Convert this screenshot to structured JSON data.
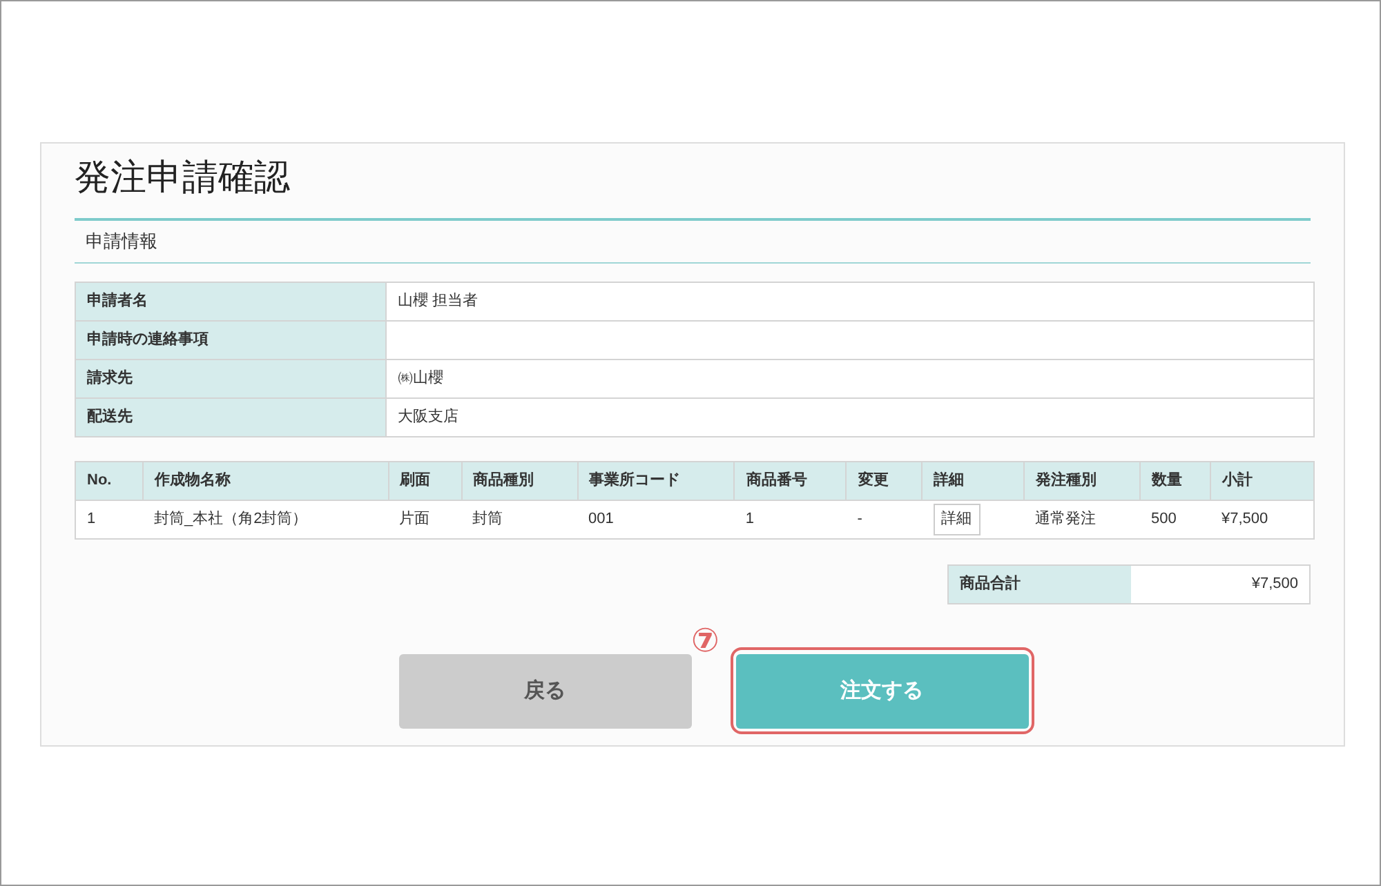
{
  "page_title": "発注申請確認",
  "section_title": "申請情報",
  "info_rows": [
    {
      "label": "申請者名",
      "value": "山櫻 担当者"
    },
    {
      "label": "申請時の連絡事項",
      "value": ""
    },
    {
      "label": "請求先",
      "value": "㈱山櫻"
    },
    {
      "label": "配送先",
      "value": "大阪支店"
    }
  ],
  "order_table": {
    "columns": [
      "No.",
      "作成物名称",
      "刷面",
      "商品種別",
      "事業所コード",
      "商品番号",
      "変更",
      "詳細",
      "発注種別",
      "数量",
      "小計"
    ],
    "rows": [
      [
        {
          "kind": "text",
          "text": "1"
        },
        {
          "kind": "text",
          "text": "封筒_本社（角2封筒）"
        },
        {
          "kind": "text",
          "text": "片面"
        },
        {
          "kind": "text",
          "text": "封筒"
        },
        {
          "kind": "text",
          "text": "001"
        },
        {
          "kind": "text",
          "text": "1"
        },
        {
          "kind": "text",
          "text": "-"
        },
        {
          "kind": "button",
          "text": "詳細"
        },
        {
          "kind": "text",
          "text": "通常発注"
        },
        {
          "kind": "text",
          "text": "500"
        },
        {
          "kind": "text",
          "text": "¥7,500"
        }
      ]
    ]
  },
  "total": {
    "label": "商品合計",
    "value": "¥7,500"
  },
  "buttons": [
    {
      "label": "戻る",
      "kind": "secondary",
      "highlighted": false
    },
    {
      "label": "注文する",
      "kind": "primary",
      "highlighted": true,
      "marker": "⑦"
    }
  ]
}
